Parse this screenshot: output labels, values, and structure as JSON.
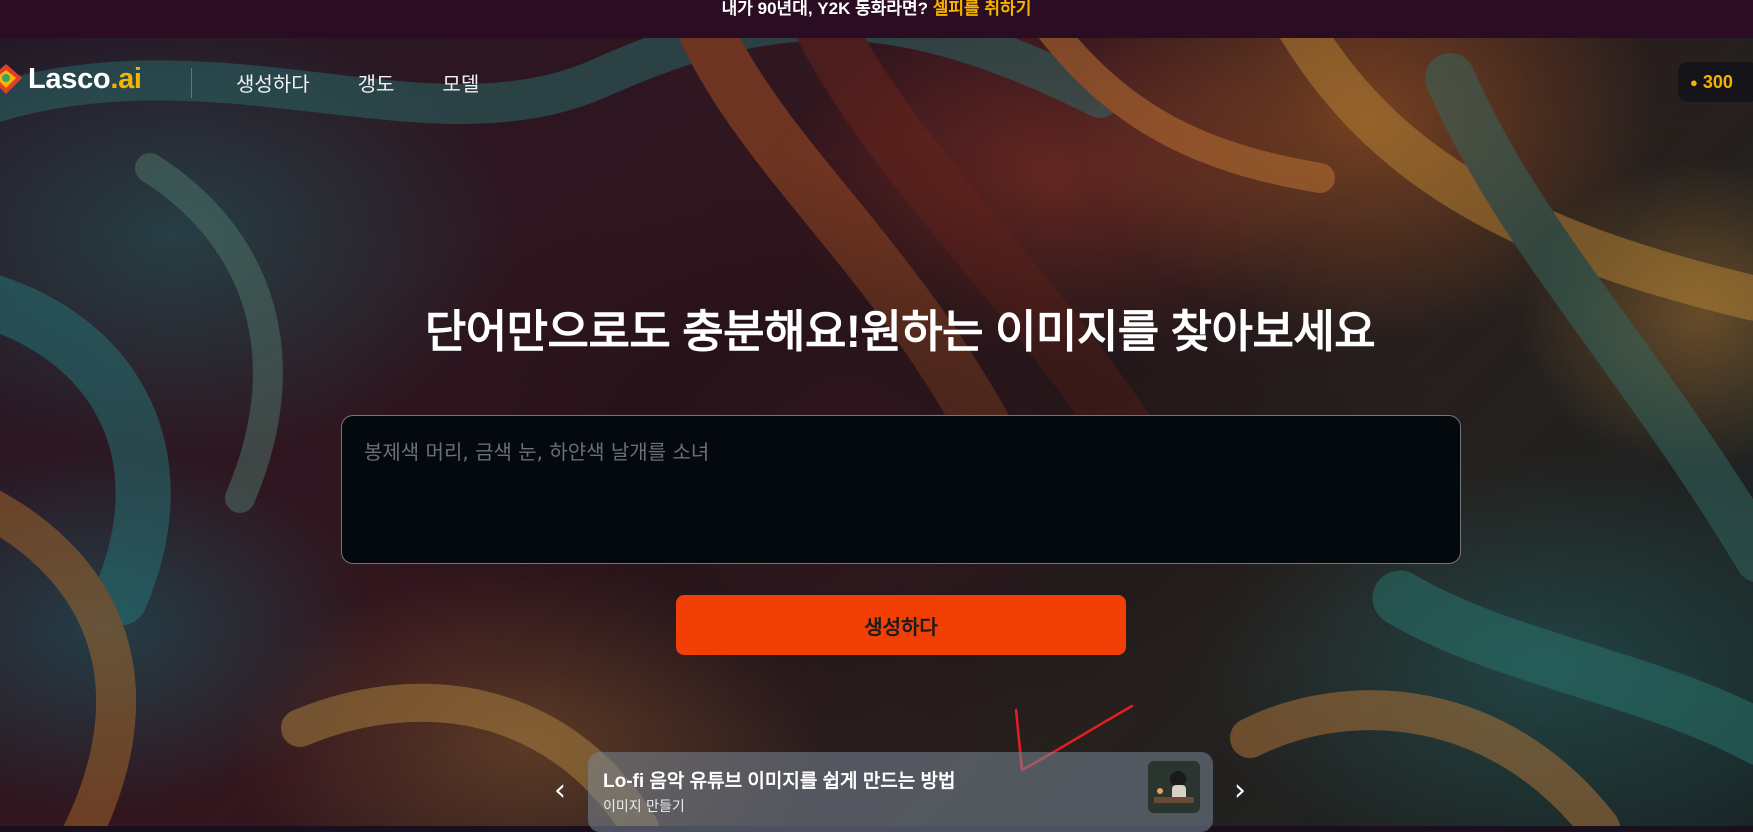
{
  "banner": {
    "text": "내가 90년대, Y2K 동화라면?",
    "cta": "셀피를 취하기"
  },
  "header": {
    "logo_main": "Lasco",
    "logo_dot": ".ai",
    "nav": [
      "생성하다",
      "갱도",
      "모델"
    ],
    "credits": "300",
    "credits_icon": "coin-icon"
  },
  "hero": {
    "headline": "단어만으로도 충분해요!원하는 이미지를 찾아보세요",
    "prompt_placeholder": "봉제색 머리, 금색 눈, 하얀색 날개를 소녀",
    "prompt_value": "",
    "generate_label": "생성하다"
  },
  "tutorial_card": {
    "title": "Lo-fi 음악 유튜브 이미지를 쉽게 만드는 방법",
    "subtitle": "이미지 만들기",
    "prev_icon": "chevron-left-icon",
    "next_icon": "chevron-right-icon"
  },
  "colors": {
    "accent_orange": "#f23f06",
    "accent_yellow": "#f6b400",
    "banner_bg": "#2a0d22"
  }
}
